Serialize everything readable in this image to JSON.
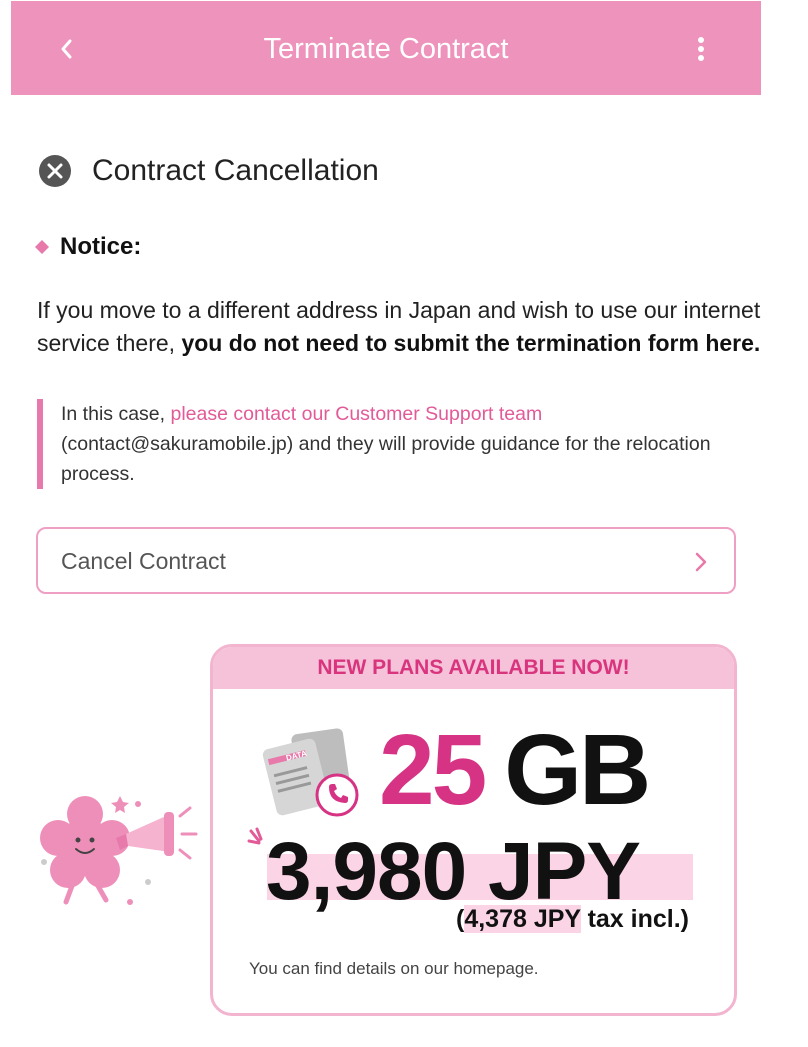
{
  "header": {
    "title": "Terminate Contract",
    "back_icon": "chevron-left-icon",
    "menu_icon": "kebab-menu-icon"
  },
  "section": {
    "title": "Contract Cancellation",
    "icon": "close-circle-icon"
  },
  "notice": {
    "label": "Notice:",
    "body_part1": "If you move to a different address in Japan and wish to use our internet service there, ",
    "body_bold": "you do not need to submit the termination form here.",
    "quote_prefix": "In this case, ",
    "quote_link": "please contact our Customer Support team",
    "quote_suffix": " (contact@sakuramobile.jp) and they will provide guidance for the relocation process."
  },
  "cancel_button": {
    "label": "Cancel Contract",
    "icon": "chevron-right-icon"
  },
  "promo": {
    "banner": "NEW PLANS AVAILABLE NOW!",
    "data_amount": "25",
    "data_unit": "GB",
    "price": "3,980 JPY",
    "tax_prefix": "(",
    "tax_value": "4,378 JPY",
    "tax_suffix": " tax incl.)",
    "details": "You can find details on our homepage.",
    "card_label": "DATA"
  },
  "colors": {
    "header_bg": "#ee93bc",
    "accent_pink": "#e25a98",
    "price_pink": "#d63384",
    "banner_bg": "#f5c2d9"
  }
}
